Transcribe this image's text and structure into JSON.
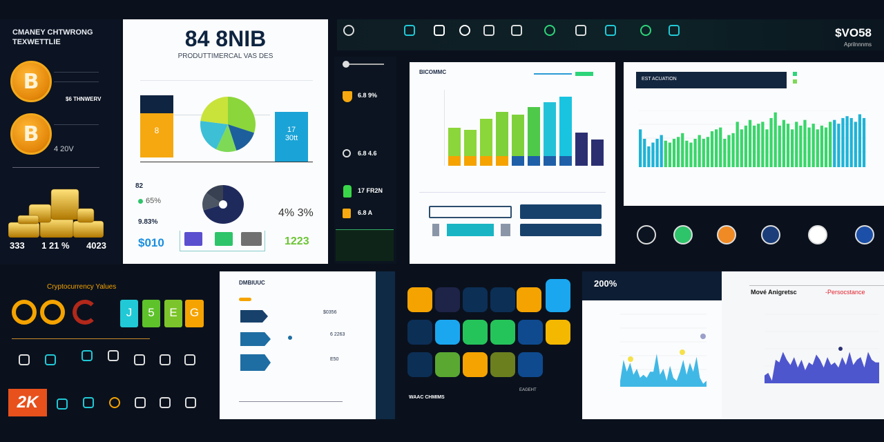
{
  "left_panel": {
    "title_line1": "CMANEY CHTWRONG",
    "title_line2": "TEXWETTLIE",
    "coin_symbol": "B",
    "coin1_label": "$6 THNWERV",
    "coin2_label": "4 20V",
    "stats": [
      "333",
      "1 21 %",
      "4023"
    ]
  },
  "report_panel": {
    "headline": "84 8NIB",
    "subtitle": "PRODUTTIMERCAL VAS DES",
    "left_bar_value": "8",
    "right_bar_value1": "17",
    "right_bar_value2": "30tt",
    "stat_82": "82",
    "stat_pct": "65%",
    "stat_small": "9.83%",
    "stat_money": "$010",
    "stat_percents": "4% 3%",
    "stat_green": "1223",
    "pie_colors": [
      "#8bd63a",
      "#1d5f9c",
      "#7ed957",
      "#3dbfd6",
      "#c9e33a"
    ],
    "donut_colors": [
      "#1f2a5c",
      "#4b5563",
      "#374151"
    ]
  },
  "top_bar": {
    "price": "$VO58",
    "price_label": "Aprilnnnms",
    "icons": [
      "circle-icon",
      "pen-icon",
      "ring-icon",
      "v-icon",
      "lock-icon",
      "key-icon",
      "card-icon",
      "info-icon",
      "camera-icon",
      "wallet-icon",
      "network-icon"
    ]
  },
  "sidebar": {
    "items": [
      {
        "label": "6.8 9%"
      },
      {
        "label": "6.8 4.6"
      },
      {
        "label": "17 FR2N"
      },
      {
        "label": "6.8 A"
      }
    ]
  },
  "bar_panel": {
    "title": "BICOMMC",
    "chart_data": {
      "type": "bar",
      "values": [
        55,
        52,
        68,
        78,
        74,
        85,
        92,
        100,
        48,
        38
      ],
      "colors": [
        "#8bd63a",
        "#8bd63a",
        "#8bd63a",
        "#7fd13b",
        "#7fd13b",
        "#4fc94a",
        "#22c3d9",
        "#19c4e0",
        "#2b2f72",
        "#2b2f72"
      ]
    }
  },
  "dense_panel": {
    "title": "EST ACUATION",
    "chart_data": {
      "type": "bar",
      "values": [
        40,
        30,
        22,
        26,
        30,
        34,
        28,
        26,
        30,
        32,
        36,
        28,
        26,
        30,
        34,
        30,
        32,
        38,
        40,
        42,
        30,
        34,
        36,
        48,
        40,
        44,
        50,
        44,
        46,
        48,
        40,
        52,
        58,
        44,
        50,
        46,
        40,
        48,
        44,
        50,
        42,
        46,
        40,
        44,
        42,
        48,
        50,
        46,
        52,
        54,
        52,
        48,
        56,
        52
      ]
    }
  },
  "app_icons": [
    "help-icon",
    "green-app-icon",
    "orange-app-icon",
    "burger-app-icon",
    "cloud-app-icon",
    "blue-app-icon"
  ],
  "crypto_values": {
    "title": "Cryptocurrency Yalues",
    "tiles": [
      "J",
      "5",
      "E",
      "G"
    ],
    "logo": "2K"
  },
  "arrow_panel": {
    "title": "DMBIUUC",
    "rows": [
      {
        "value": "$0356"
      },
      {
        "value": "6 2263"
      },
      {
        "value": "E50"
      }
    ]
  },
  "tile_grid": {
    "colors": [
      "#f5a300",
      "#1e2447",
      "#0c2f56",
      "#0c2f56",
      "#f5a300",
      "#1aa7f0",
      "#0c2f56",
      "#1aa7f0",
      "#25c45a",
      "#25c45a",
      "#0f4a8f",
      "#f5b800",
      "#0c2f56",
      "#5aa832",
      "#f5a300",
      "#6b7f1f",
      "#0f4a8f"
    ],
    "caption1": "WAAC CHMIMS",
    "caption2": "EAGEHT"
  },
  "area_panel_left": {
    "header_value": "200%",
    "chart_data": {
      "type": "area",
      "values": [
        2,
        9,
        5,
        8,
        4,
        6,
        3,
        4,
        3,
        5,
        5,
        11,
        4,
        6,
        2,
        7,
        3,
        2,
        5,
        9,
        4,
        8,
        5,
        10,
        3,
        1,
        2
      ],
      "color": "#2bb0e3",
      "points": [
        "#f5e14a",
        "#f5e14a",
        "#9aa0c9"
      ]
    }
  },
  "area_panel_right": {
    "title": "Mové Anigretsc",
    "accent_label": "-Persocstance",
    "accent_color": "#e0202a",
    "chart_data": {
      "type": "area",
      "values": [
        3,
        4,
        1,
        9,
        8,
        12,
        9,
        7,
        10,
        6,
        9,
        5,
        8,
        7,
        11,
        9,
        6,
        10,
        7,
        8,
        6,
        10,
        7,
        12,
        7,
        9,
        10,
        6,
        12,
        9,
        8,
        8
      ],
      "color": "#3c44c9"
    }
  }
}
